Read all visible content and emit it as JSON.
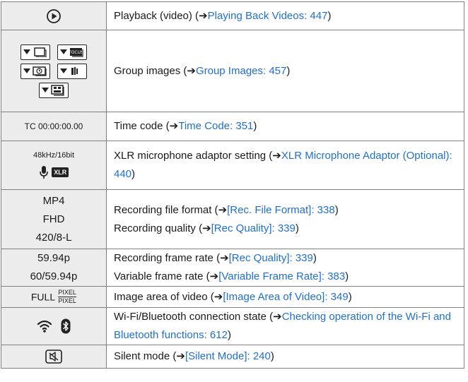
{
  "colors": {
    "link": "#1f6fcf",
    "icon_bg": "#ececec",
    "border": "#7f7f7f"
  },
  "arrow": "➔",
  "rows": [
    {
      "icon": "playback-icon",
      "desc": [
        {
          "text": "Playback (video) (",
          "link": "Playing Back Videos: 447",
          "tail": ")"
        }
      ]
    },
    {
      "icon": "group-images-icons",
      "desc": [
        {
          "text": "Group images (",
          "link": "Group Images: 457",
          "tail": ")"
        }
      ]
    },
    {
      "icon_text": [
        "TC 00:00:00.00"
      ],
      "desc": [
        {
          "text": "Time code (",
          "link": "Time Code: 351",
          "tail": ")"
        }
      ]
    },
    {
      "icon_text": [
        "48kHz/16bit"
      ],
      "xlr": "XLR",
      "desc": [
        {
          "text": "XLR microphone adaptor setting (",
          "link": "XLR Microphone Adaptor (Optional): 440",
          "tail": ")"
        }
      ]
    },
    {
      "icon_text": [
        "MP4",
        "FHD",
        "420/8-L"
      ],
      "desc": [
        {
          "text": "Recording file format (",
          "link": "[Rec. File Format]: 338",
          "tail": ")"
        },
        {
          "text": "Recording quality (",
          "link": "[Rec Quality]: 339",
          "tail": ")"
        }
      ]
    },
    {
      "icon_text": [
        "59.94p",
        "60/59.94p"
      ],
      "desc": [
        {
          "text": "Recording frame rate (",
          "link": "[Rec Quality]: 339",
          "tail": ")"
        },
        {
          "text": "Variable frame rate (",
          "link": "[Variable Frame Rate]: 383",
          "tail": ")"
        }
      ]
    },
    {
      "icon_text": [
        "FULL"
      ],
      "frac": [
        "PIXEL",
        "PIXEL"
      ],
      "desc": [
        {
          "text": "Image area of video (",
          "link": "[Image Area of Video]: 349",
          "tail": ")"
        }
      ]
    },
    {
      "icon": "wifi-bluetooth-icons",
      "desc": [
        {
          "text": "Wi-Fi/Bluetooth connection state (",
          "link": "Checking operation of the Wi-Fi and Bluetooth functions: 612",
          "tail": ")"
        }
      ]
    },
    {
      "icon": "silent-mode-icon",
      "desc": [
        {
          "text": "Silent mode (",
          "link": "[Silent Mode]: 240",
          "tail": ")"
        }
      ]
    }
  ]
}
